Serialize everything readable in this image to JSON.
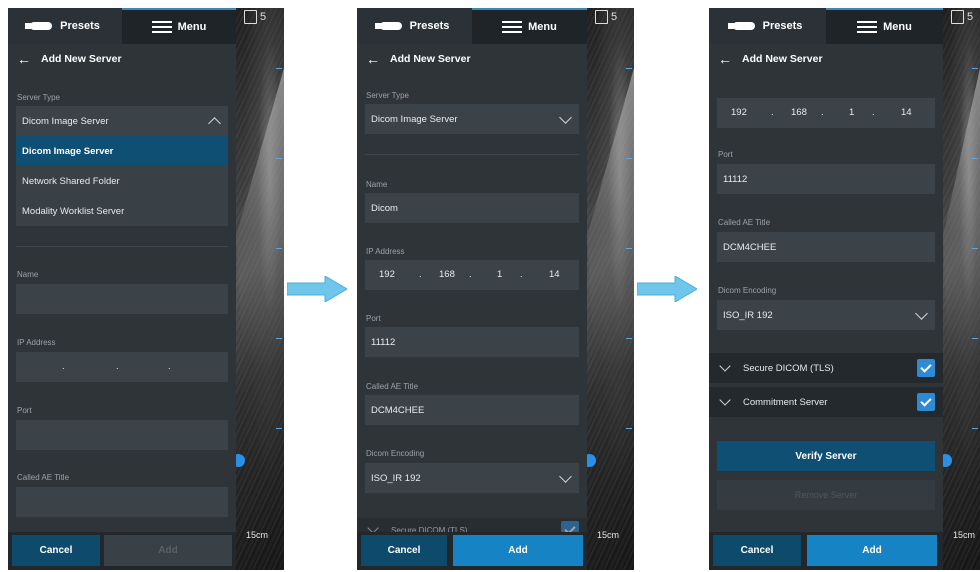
{
  "topbar": {
    "presets_label": "Presets",
    "menu_label": "Menu"
  },
  "header": {
    "title": "Add New Server"
  },
  "ultrasound": {
    "frame_number": "5",
    "depth_label": "15cm"
  },
  "panel1": {
    "server_type_label": "Server Type",
    "server_type_value": "Dicom Image Server",
    "dropdown_options": [
      "Dicom Image Server",
      "Network Shared Folder",
      "Modality Worklist Server"
    ],
    "name_label": "Name",
    "ip_label": "IP Address",
    "ip_dot": ".",
    "port_label": "Port",
    "called_ae_label": "Called AE Title",
    "cancel_label": "Cancel",
    "add_label": "Add"
  },
  "panel2": {
    "server_type_label": "Server Type",
    "server_type_value": "Dicom Image Server",
    "name_label": "Name",
    "name_value": "Dicom",
    "ip_label": "IP Address",
    "ip_octets": [
      "192",
      "168",
      "1",
      "14"
    ],
    "ip_dot": ".",
    "port_label": "Port",
    "port_value": "11112",
    "called_ae_label": "Called AE Title",
    "called_ae_value": "DCM4CHEE",
    "encoding_label": "Dicom Encoding",
    "encoding_value": "ISO_IR 192",
    "partial_row_label": "Secure DICOM (TLS)",
    "cancel_label": "Cancel",
    "add_label": "Add"
  },
  "panel3": {
    "ip_octets": [
      "192",
      "168",
      "1",
      "14"
    ],
    "ip_dot": ".",
    "port_label": "Port",
    "port_value": "11112",
    "called_ae_label": "Called AE Title",
    "called_ae_value": "DCM4CHEE",
    "encoding_label": "Dicom Encoding",
    "encoding_value": "ISO_IR 192",
    "secure_label": "Secure DICOM (TLS)",
    "commitment_label": "Commitment Server",
    "verify_label": "Verify Server",
    "remove_label": "Remove Server",
    "cancel_label": "Cancel",
    "add_label": "Add"
  },
  "colors": {
    "accent": "#1583c4",
    "selected": "#0f4f73",
    "arrow": "#6ec6ea"
  }
}
